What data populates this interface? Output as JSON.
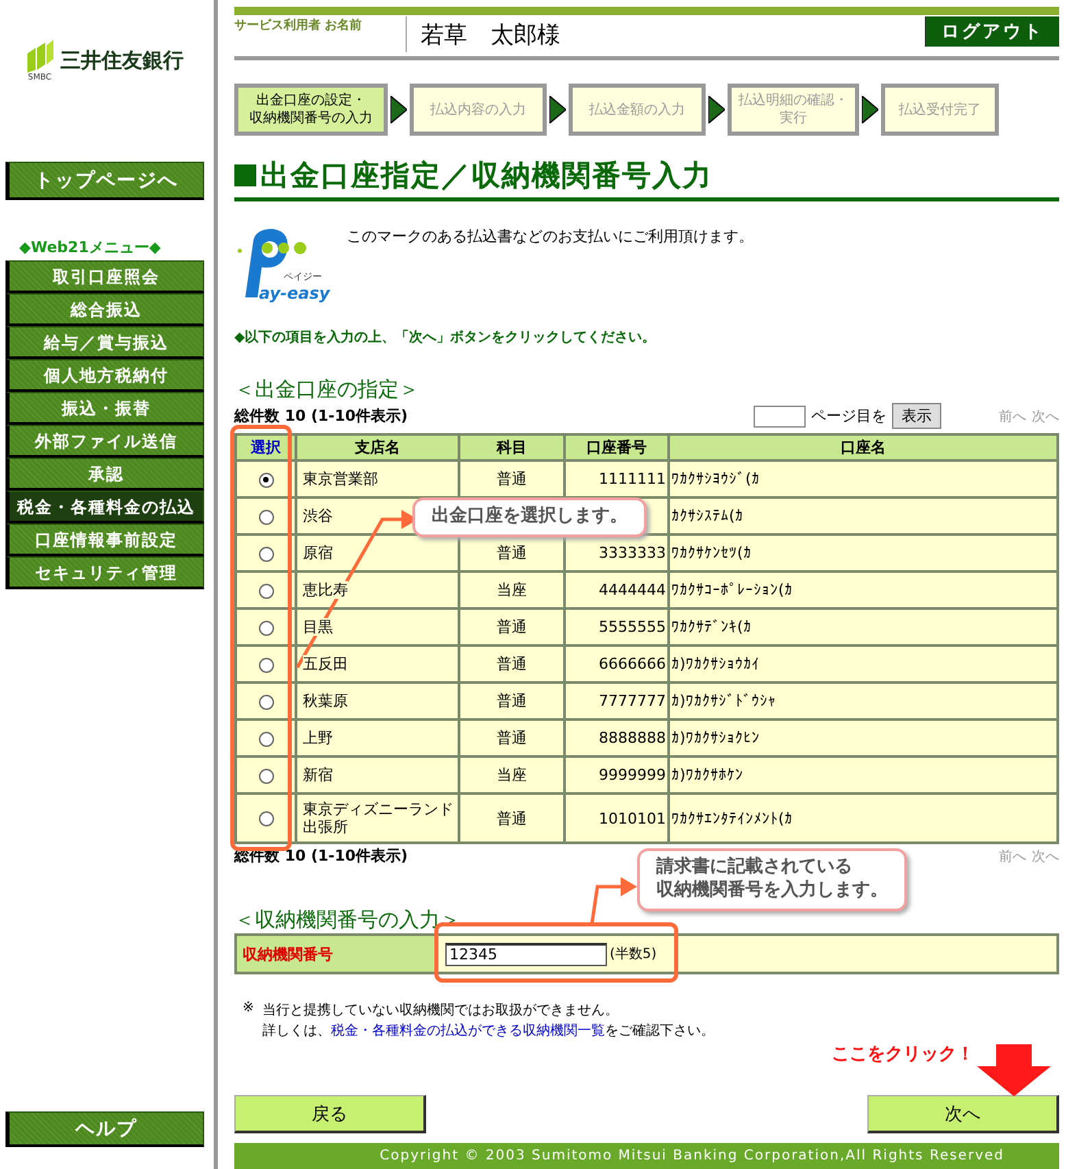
{
  "sidebar": {
    "logo_text": "三井住友銀行",
    "logo_subtext": "SMBC",
    "top_button": "トップページへ",
    "menu_heading": "◆Web21メニュー◆",
    "menu_items": [
      {
        "label": "取引口座照会",
        "selected": false
      },
      {
        "label": "総合振込",
        "selected": false
      },
      {
        "label": "給与／賞与振込",
        "selected": false
      },
      {
        "label": "個人地方税納付",
        "selected": false
      },
      {
        "label": "振込・振替",
        "selected": false
      },
      {
        "label": "外部ファイル送信",
        "selected": false
      },
      {
        "label": "承認",
        "selected": false
      },
      {
        "label": "税金・各種料金の払込",
        "selected": true
      },
      {
        "label": "口座情報事前設定",
        "selected": false
      },
      {
        "label": "セキュリティ管理",
        "selected": false
      }
    ],
    "help_button": "ヘルプ"
  },
  "header": {
    "user_label": "サービス利用者 お名前",
    "user_name": "若草　太郎様",
    "logout_button": "ログアウト"
  },
  "steps": [
    {
      "lines": [
        "出金口座の設定・",
        "収納機関番号の入力"
      ],
      "current": true
    },
    {
      "lines": [
        "払込内容の入力"
      ],
      "current": false
    },
    {
      "lines": [
        "払込金額の入力"
      ],
      "current": false
    },
    {
      "lines": [
        "払込明細の確認・",
        "実行"
      ],
      "current": false
    },
    {
      "lines": [
        "払込受付完了"
      ],
      "current": false
    }
  ],
  "page_title": "出金口座指定／収納機関番号入力",
  "payeasy": {
    "logo_kana": "ペイジー",
    "logo_text": "ay-easy",
    "text": "このマークのある払込書などのお支払いにご利用頂けます。"
  },
  "instruction": "◆以下の項目を入力の上、「次へ」ボタンをクリックしてください。",
  "account_section": {
    "heading": "＜出金口座の指定＞",
    "count_top": "総件数 10 (1-10件表示)",
    "page_suffix": "ページ目を",
    "show_button": "表示",
    "pager_top": [
      {
        "label": "前へ",
        "disabled": true
      },
      {
        "label": "次へ",
        "disabled": true
      }
    ],
    "columns": [
      "選択",
      "支店名",
      "科目",
      "口座番号",
      "口座名"
    ],
    "rows": [
      {
        "selected": true,
        "branch": [
          "東京営業部"
        ],
        "subject": "普通",
        "number": "1111111",
        "name": "ﾜｶｸｻｼﾖｳｼﾞ(ｶ"
      },
      {
        "selected": false,
        "branch": [
          "渋谷"
        ],
        "name": "ｶｸｻｼｽﾃﾑ(ｶ"
      },
      {
        "selected": false,
        "branch": [
          "原宿"
        ],
        "subject": "普通",
        "number": "3333333",
        "name": "ﾜｶｸｻｹﾝｾﾂ(ｶ"
      },
      {
        "selected": false,
        "branch": [
          "恵比寿"
        ],
        "subject": "当座",
        "number": "4444444",
        "name": "ﾜｶｸｻｺｰﾎﾟﾚｰｼｮﾝ(ｶ"
      },
      {
        "selected": false,
        "branch": [
          "目黒"
        ],
        "subject": "普通",
        "number": "5555555",
        "name": "ﾜｶｸｻﾃﾞﾝｷ(ｶ"
      },
      {
        "selected": false,
        "branch": [
          "五反田"
        ],
        "subject": "普通",
        "number": "6666666",
        "name": "ｶ)ﾜｶｸｻｼｮｳｶｲ"
      },
      {
        "selected": false,
        "branch": [
          "秋葉原"
        ],
        "subject": "普通",
        "number": "7777777",
        "name": "ｶ)ﾜｶｸｻｼﾞﾄﾞｳｼｬ"
      },
      {
        "selected": false,
        "branch": [
          "上野"
        ],
        "subject": "普通",
        "number": "8888888",
        "name": "ｶ)ﾜｶｸｻｼｮｸﾋﾝ"
      },
      {
        "selected": false,
        "branch": [
          "新宿"
        ],
        "subject": "当座",
        "number": "9999999",
        "name": "ｶ)ﾜｶｸｻﾎｹﾝ"
      },
      {
        "selected": false,
        "branch": [
          "東京ディズニーランド",
          "出張所"
        ],
        "subject": "普通",
        "number": "1010101",
        "name": "ﾜｶｸｻｴﾝﾀﾃｲﾝﾒﾝﾄ(ｶ"
      }
    ],
    "count_bottom": "総件数 10 (1-10件表示)",
    "pager_bottom": [
      {
        "label": "前へ",
        "disabled": true
      },
      {
        "label": "次へ",
        "disabled": true
      }
    ]
  },
  "agency_section": {
    "heading": "＜収納機関番号の入力＞",
    "label": "収納機関番号",
    "value": "12345",
    "hint": "(半数5)"
  },
  "note": {
    "mark": "※",
    "line1": "当行と提携していない収納機関ではお取扱ができません。",
    "before_link": "詳しくは、",
    "link": "税金・各種料金の払込ができる収納機関一覧",
    "after_link": "をご確認下さい。"
  },
  "buttons": {
    "back": "戻る",
    "next": "次へ"
  },
  "annotations": [
    {
      "kind": "callout",
      "lines": [
        "出金口座を選択します。"
      ]
    },
    {
      "kind": "callout",
      "lines": [
        "請求書に記載されている",
        "収納機関番号を入力します。"
      ]
    },
    {
      "kind": "click_hint",
      "lines": [
        "ここをクリック！"
      ]
    }
  ],
  "footer": "Copyright © 2003 Sumitomo Mitsui Banking Corporation,All Rights Reserved"
}
